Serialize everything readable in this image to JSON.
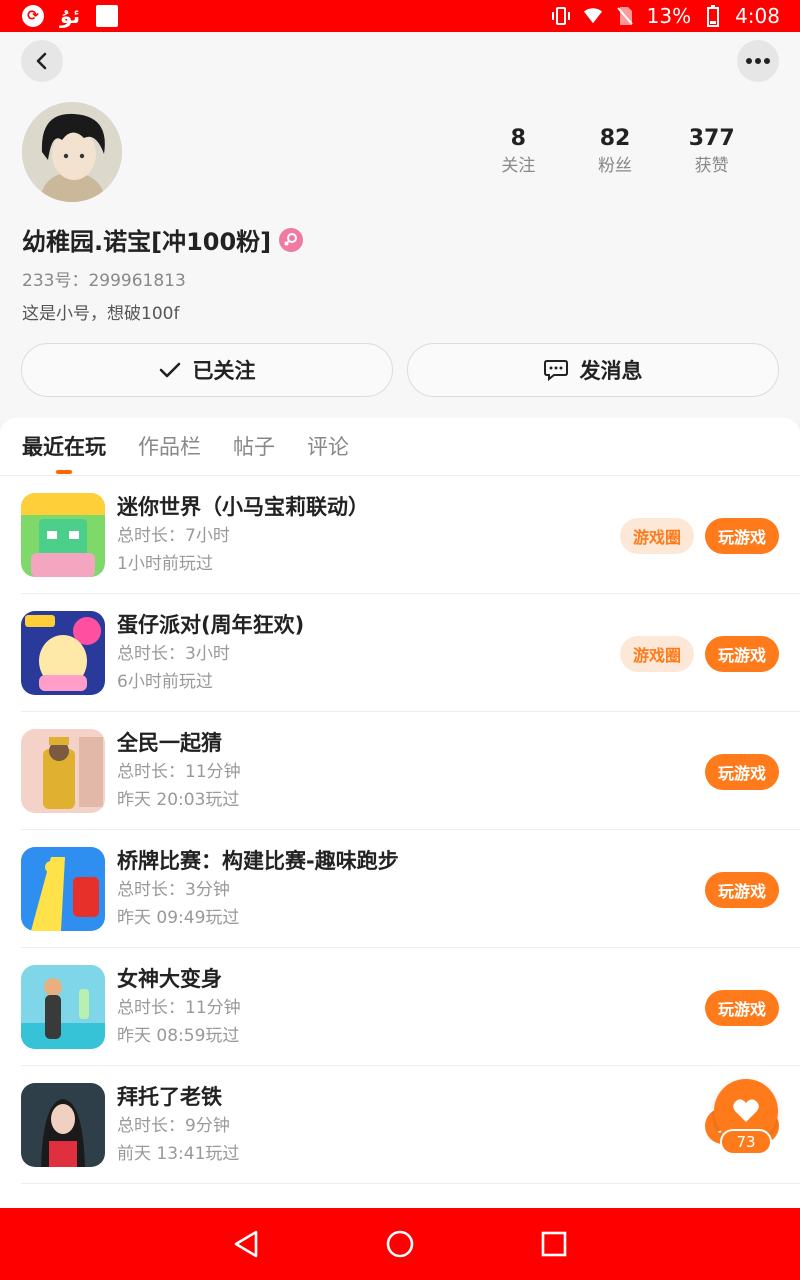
{
  "status_bar": {
    "battery": "13%",
    "time": "4:08",
    "glyph": "ئۇ"
  },
  "profile": {
    "stats": [
      {
        "num": "8",
        "label": "关注"
      },
      {
        "num": "82",
        "label": "粉丝"
      },
      {
        "num": "377",
        "label": "获赞"
      }
    ],
    "name": "幼稚园.诺宝[冲100粉]",
    "uid": "233号：299961813",
    "bio": "这是小号，想破100f"
  },
  "actions": {
    "follow_label": "已关注",
    "message_label": "发消息"
  },
  "tabs": [
    "最近在玩",
    "作品栏",
    "帖子",
    "评论"
  ],
  "games": [
    {
      "name": "迷你世界（小马宝莉联动）",
      "duration": "总时长：7小时",
      "last_played": "1小时前玩过",
      "circle_label": "游戏圈",
      "play_label": "玩游戏"
    },
    {
      "name": "蛋仔派对(周年狂欢)",
      "duration": "总时长：3小时",
      "last_played": "6小时前玩过",
      "circle_label": "游戏圈",
      "play_label": "玩游戏"
    },
    {
      "name": "全民一起猜",
      "duration": "总时长：11分钟",
      "last_played": "昨天 20:03玩过",
      "play_label": "玩游戏"
    },
    {
      "name": "桥牌比赛：构建比赛-趣味跑步",
      "duration": "总时长：3分钟",
      "last_played": "昨天 09:49玩过",
      "play_label": "玩游戏"
    },
    {
      "name": "女神大变身",
      "duration": "总时长：11分钟",
      "last_played": "昨天 08:59玩过",
      "play_label": "玩游戏"
    },
    {
      "name": "拜托了老铁",
      "duration": "总时长：9分钟",
      "last_played": "前天 13:41玩过",
      "play_label": "玩游戏"
    }
  ],
  "like": {
    "count": "73"
  },
  "colors": {
    "accent": "#ff7a1a",
    "status_bar": "#ff0000",
    "circle_bg": "#fde8d8"
  }
}
